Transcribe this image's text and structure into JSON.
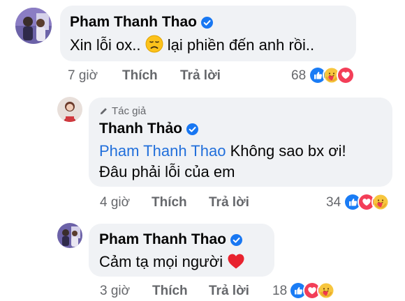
{
  "comments": [
    {
      "author": "Pham Thanh Thao",
      "verified_icon": "verified-badge-icon",
      "text_before_emoji": "Xin lỗi ox..",
      "emoji": "disappointed-face-emoji",
      "text_after_emoji": "lại phiền đến anh rồi..",
      "time": "7 giờ",
      "like_label": "Thích",
      "reply_label": "Trả lời",
      "reaction_count": "68",
      "reactions": [
        "like-reaction-icon",
        "care-reaction-icon",
        "love-reaction-icon"
      ],
      "reply": {
        "author_tag": "Tác giả",
        "author": "Thanh Thảo",
        "mention": "Pham Thanh Thao",
        "text_line1": "Không sao bx ơi!",
        "text_line2": "Đâu phải lỗi của em",
        "time": "4 giờ",
        "like_label": "Thích",
        "reply_label": "Trả lời",
        "reaction_count": "34",
        "reactions": [
          "like-reaction-icon",
          "love-reaction-icon",
          "care-reaction-icon"
        ]
      }
    },
    {
      "author": "Pham Thanh Thao",
      "text": "Cảm tạ mọi người",
      "emoji": "red-heart-emoji",
      "time": "3 giờ",
      "like_label": "Thích",
      "reply_label": "Trả lời",
      "reaction_count": "18",
      "reactions": [
        "like-reaction-icon",
        "love-reaction-icon",
        "care-reaction-icon"
      ]
    }
  ],
  "colors": {
    "bubble": "#f0f2f5",
    "meta_text": "#65676b",
    "mention": "#216fdb",
    "verified": "#1877f2"
  }
}
